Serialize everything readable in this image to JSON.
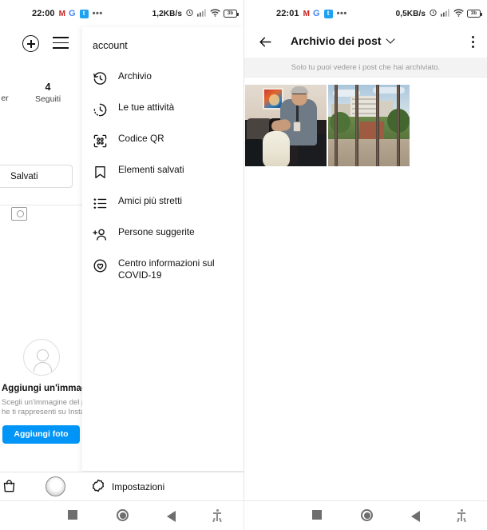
{
  "left_screen": {
    "status_bar": {
      "time": "22:00",
      "icons": [
        "gmail-icon",
        "google-icon",
        "twitter-icon",
        "overflow-dots-icon"
      ],
      "network_speed": "1,2KB/s",
      "right_icons": [
        "alarm-icon",
        "signal-icon",
        "wifi-icon"
      ],
      "battery": "3b"
    },
    "profile": {
      "stat_partial_label": "er",
      "following_count": "4",
      "following_label": "Seguiti",
      "saved_tab_label": "Salvati",
      "add_photo": {
        "title": "Aggiungi un'immagin profilo",
        "subtitle_line1": "Scegli un'immagine del p",
        "subtitle_line2": "he ti rappresenti su Insta",
        "button_label": "Aggiungi foto",
        "button_color": "#0095f6"
      }
    },
    "menu_sheet": {
      "title": "account",
      "items": [
        {
          "label": "Archivio",
          "icon": "clock-rewind-icon"
        },
        {
          "label": "Le tue attività",
          "icon": "activity-clock-icon"
        },
        {
          "label": "Codice QR",
          "icon": "qr-code-icon"
        },
        {
          "label": "Elementi salvati",
          "icon": "bookmark-icon"
        },
        {
          "label": "Amici più stretti",
          "icon": "close-friends-list-icon"
        },
        {
          "label": "Persone suggerite",
          "icon": "person-add-icon"
        },
        {
          "label": "Centro informazioni sul COVID-19",
          "icon": "covid-info-icon"
        }
      ],
      "settings_label": "Impostazioni",
      "settings_icon": "gear-icon"
    },
    "bottom_bar": {
      "shop_icon": "shop-bag-icon",
      "avatar_icon": "profile-avatar-icon",
      "gear_icon": "gear-icon"
    }
  },
  "right_screen": {
    "status_bar": {
      "time": "22:01",
      "icons": [
        "gmail-icon",
        "google-icon",
        "twitter-icon",
        "overflow-dots-icon"
      ],
      "network_speed": "0,5KB/s",
      "right_icons": [
        "alarm-icon",
        "signal-icon",
        "wifi-icon"
      ],
      "battery": "3b"
    },
    "header": {
      "back_icon": "back-arrow-icon",
      "title": "Archivio dei post",
      "dropdown_icon": "chevron-down-icon",
      "menu_icon": "kebab-menu-icon"
    },
    "banner_text": "Solo tu puoi vedere i post che hai archiviato.",
    "grid": {
      "posts": [
        {
          "alt": "Uomo seduto su un divano con lampada"
        },
        {
          "alt": "Vista sulla citta attraverso le sbarre della finestra"
        }
      ]
    }
  },
  "nav_bar": {
    "buttons": [
      "recents-square-icon",
      "home-circle-icon",
      "back-triangle-icon",
      "accessibility-icon"
    ]
  }
}
